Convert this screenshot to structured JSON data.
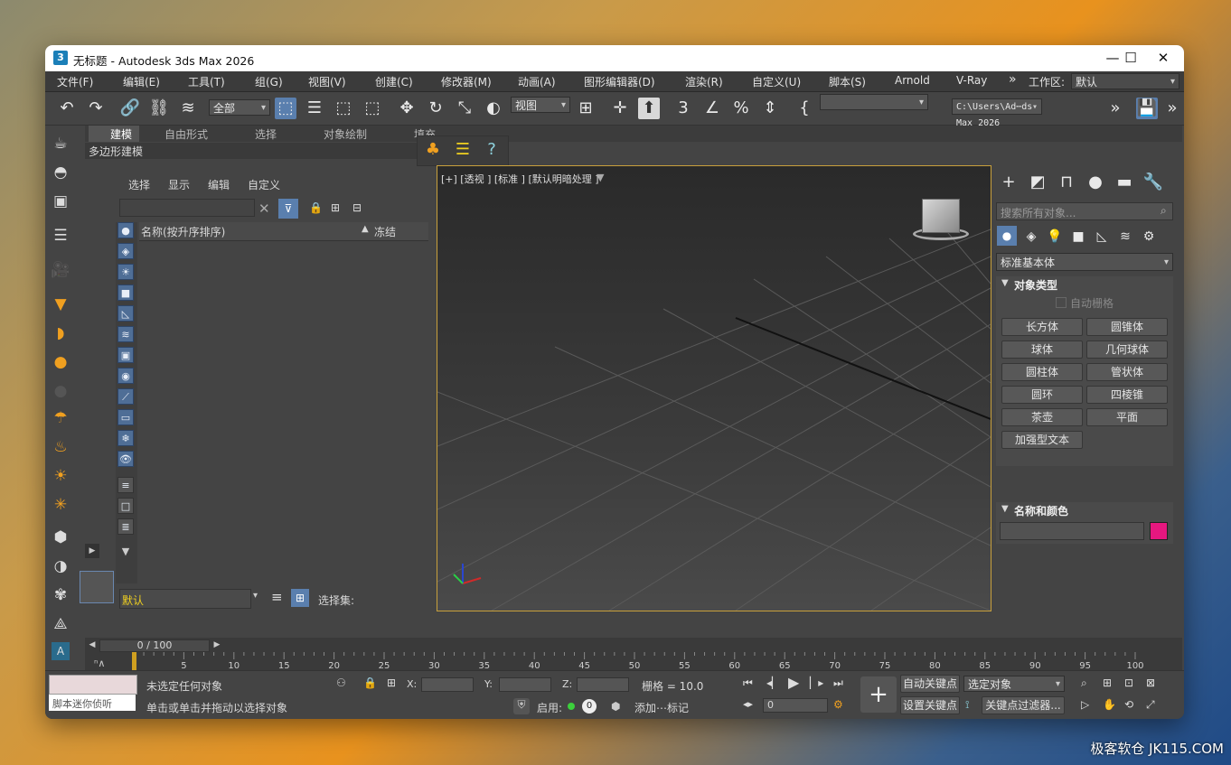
{
  "window": {
    "title": "无标题 - Autodesk 3ds Max 2026",
    "app_icon": "3"
  },
  "menu": {
    "items": [
      "文件(F)",
      "编辑(E)",
      "工具(T)",
      "组(G)",
      "视图(V)",
      "创建(C)",
      "修改器(M)",
      "动画(A)",
      "图形编辑器(D)",
      "渲染(R)",
      "自定义(U)",
      "脚本(S)",
      "Arnold",
      "V-Ray"
    ],
    "overflow": "»",
    "workspace_label": "工作区:",
    "workspace_value": "默认"
  },
  "toolbar": {
    "selection_filter": "全部",
    "ref_coord": "视图",
    "path": "C:\\Users\\Ad⋯ds Max 2026"
  },
  "ribbon": {
    "tabs": [
      "建模",
      "自由形式",
      "选择",
      "对象绘制",
      "填充"
    ],
    "sub": "多边形建模"
  },
  "scene_explorer": {
    "menu": [
      "选择",
      "显示",
      "编辑",
      "自定义"
    ],
    "col_name": "名称(按升序排序)",
    "col_sort": "▲",
    "col_freeze": "冻结",
    "layer_value": "默认",
    "selection_set_label": "选择集:"
  },
  "viewport": {
    "label": "[+] [透视 ] [标准 ] [默认明暗处理 ]"
  },
  "command_panel": {
    "search_placeholder": "搜索所有对象...",
    "category": "标准基本体",
    "rollout_object_type": "对象类型",
    "auto_grid": "自动栅格",
    "buttons": [
      "长方体",
      "圆锥体",
      "球体",
      "几何球体",
      "圆柱体",
      "管状体",
      "圆环",
      "四棱锥",
      "茶壶",
      "平面",
      "加强型文本"
    ],
    "rollout_name_color": "名称和颜色",
    "object_color": "#e6177f"
  },
  "timeline": {
    "frame_display": "0 / 100",
    "ticks": [
      "0",
      "5",
      "10",
      "15",
      "20",
      "25",
      "30",
      "35",
      "40",
      "45",
      "50",
      "55",
      "60",
      "65",
      "70",
      "75",
      "80",
      "85",
      "90",
      "95",
      "100"
    ]
  },
  "status": {
    "maxscript_hint": "脚本迷你侦听",
    "line1": "未选定任何对象",
    "line2": "单击或单击并拖动以选择对象",
    "x_label": "X:",
    "y_label": "Y:",
    "z_label": "Z:",
    "grid": "栅格 = 10.0",
    "enable_label": "启用:",
    "enable_value": "0",
    "add_tag": "添加⋯标记",
    "auto_key": "自动关键点",
    "set_key": "设置关键点",
    "selected_object": "选定对象",
    "key_filter": "关键点过滤器...",
    "frame_value": "0"
  },
  "watermark": "极客软仓 JK115.COM"
}
